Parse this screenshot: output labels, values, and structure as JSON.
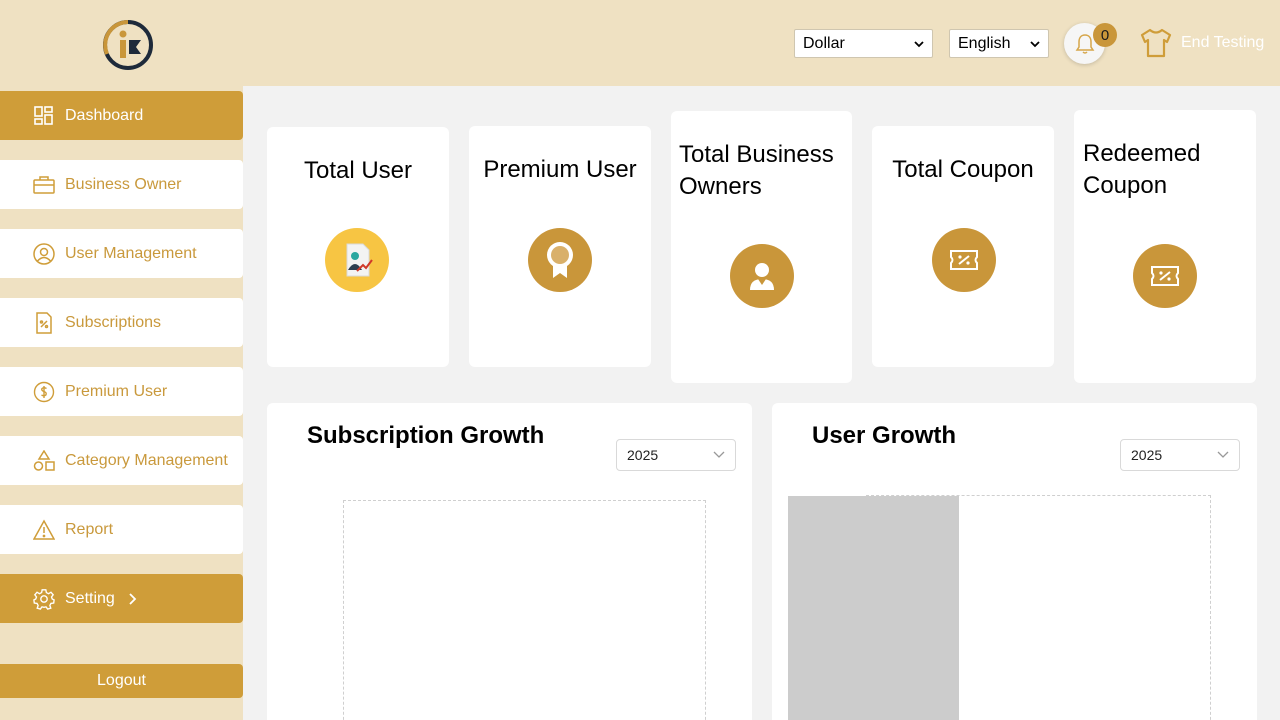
{
  "header": {
    "currency": "Dollar",
    "language": "English",
    "notification_count": "0",
    "end_testing_label": "End Testing"
  },
  "sidebar": {
    "items": [
      {
        "label": "Dashboard",
        "icon": "dashboard-icon",
        "active": true
      },
      {
        "label": "Business Owner",
        "icon": "briefcase-icon"
      },
      {
        "label": "User Management",
        "icon": "user-circle-icon"
      },
      {
        "label": "Subscriptions",
        "icon": "document-percent-icon"
      },
      {
        "label": "Premium User",
        "icon": "dollar-coin-icon"
      },
      {
        "label": "Category Management",
        "icon": "shapes-icon"
      },
      {
        "label": "Report",
        "icon": "warning-triangle-icon"
      },
      {
        "label": "Setting",
        "icon": "gear-icon",
        "active": true
      }
    ],
    "logout_label": "Logout"
  },
  "stats": [
    {
      "title": "Total User",
      "icon": "user-report-icon"
    },
    {
      "title": "Premium User",
      "icon": "award-ribbon-icon"
    },
    {
      "title": "Total Business Owners",
      "icon": "person-icon"
    },
    {
      "title": "Total Coupon",
      "icon": "coupon-icon"
    },
    {
      "title": "Redeemed Coupon",
      "icon": "coupon-icon"
    }
  ],
  "charts": {
    "subscription": {
      "title": "Subscription Growth",
      "year": "2025"
    },
    "user": {
      "title": "User Growth",
      "year": "2025"
    }
  },
  "colors": {
    "accent": "#cf9d39",
    "header_bg": "#efe1c2",
    "content_bg": "#f2f2f2"
  }
}
